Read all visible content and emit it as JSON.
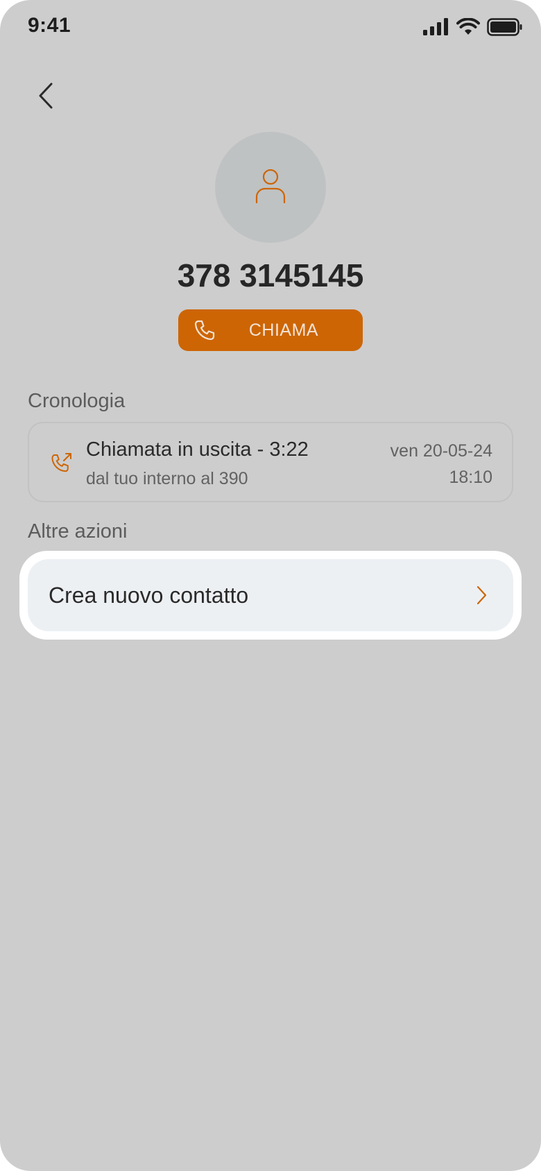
{
  "status_bar": {
    "time": "9:41",
    "icons": [
      "signal-icon",
      "wifi-icon",
      "battery-icon"
    ]
  },
  "navigation": {
    "back_icon": "chevron-left-icon"
  },
  "contact": {
    "avatar_icon": "person-icon",
    "phone_number": "378 3145145"
  },
  "call_button": {
    "icon": "phone-icon",
    "label": "CHIAMA"
  },
  "history": {
    "section_label": "Cronologia",
    "entries": [
      {
        "icon": "outgoing-call-icon",
        "title": "Chiamata in uscita - 3:22",
        "subtitle": "dal tuo interno al 390",
        "date": "ven 20-05-24",
        "time": "18:10"
      }
    ]
  },
  "actions": {
    "section_label": "Altre azioni",
    "items": [
      {
        "label": "Crea nuovo contatto",
        "icon": "chevron-right-icon"
      }
    ]
  },
  "colors": {
    "accent": "#cd6505",
    "background": "#cdcdcd",
    "avatar_bg": "#bfc2c3",
    "action_item_bg": "#edf0f3"
  }
}
